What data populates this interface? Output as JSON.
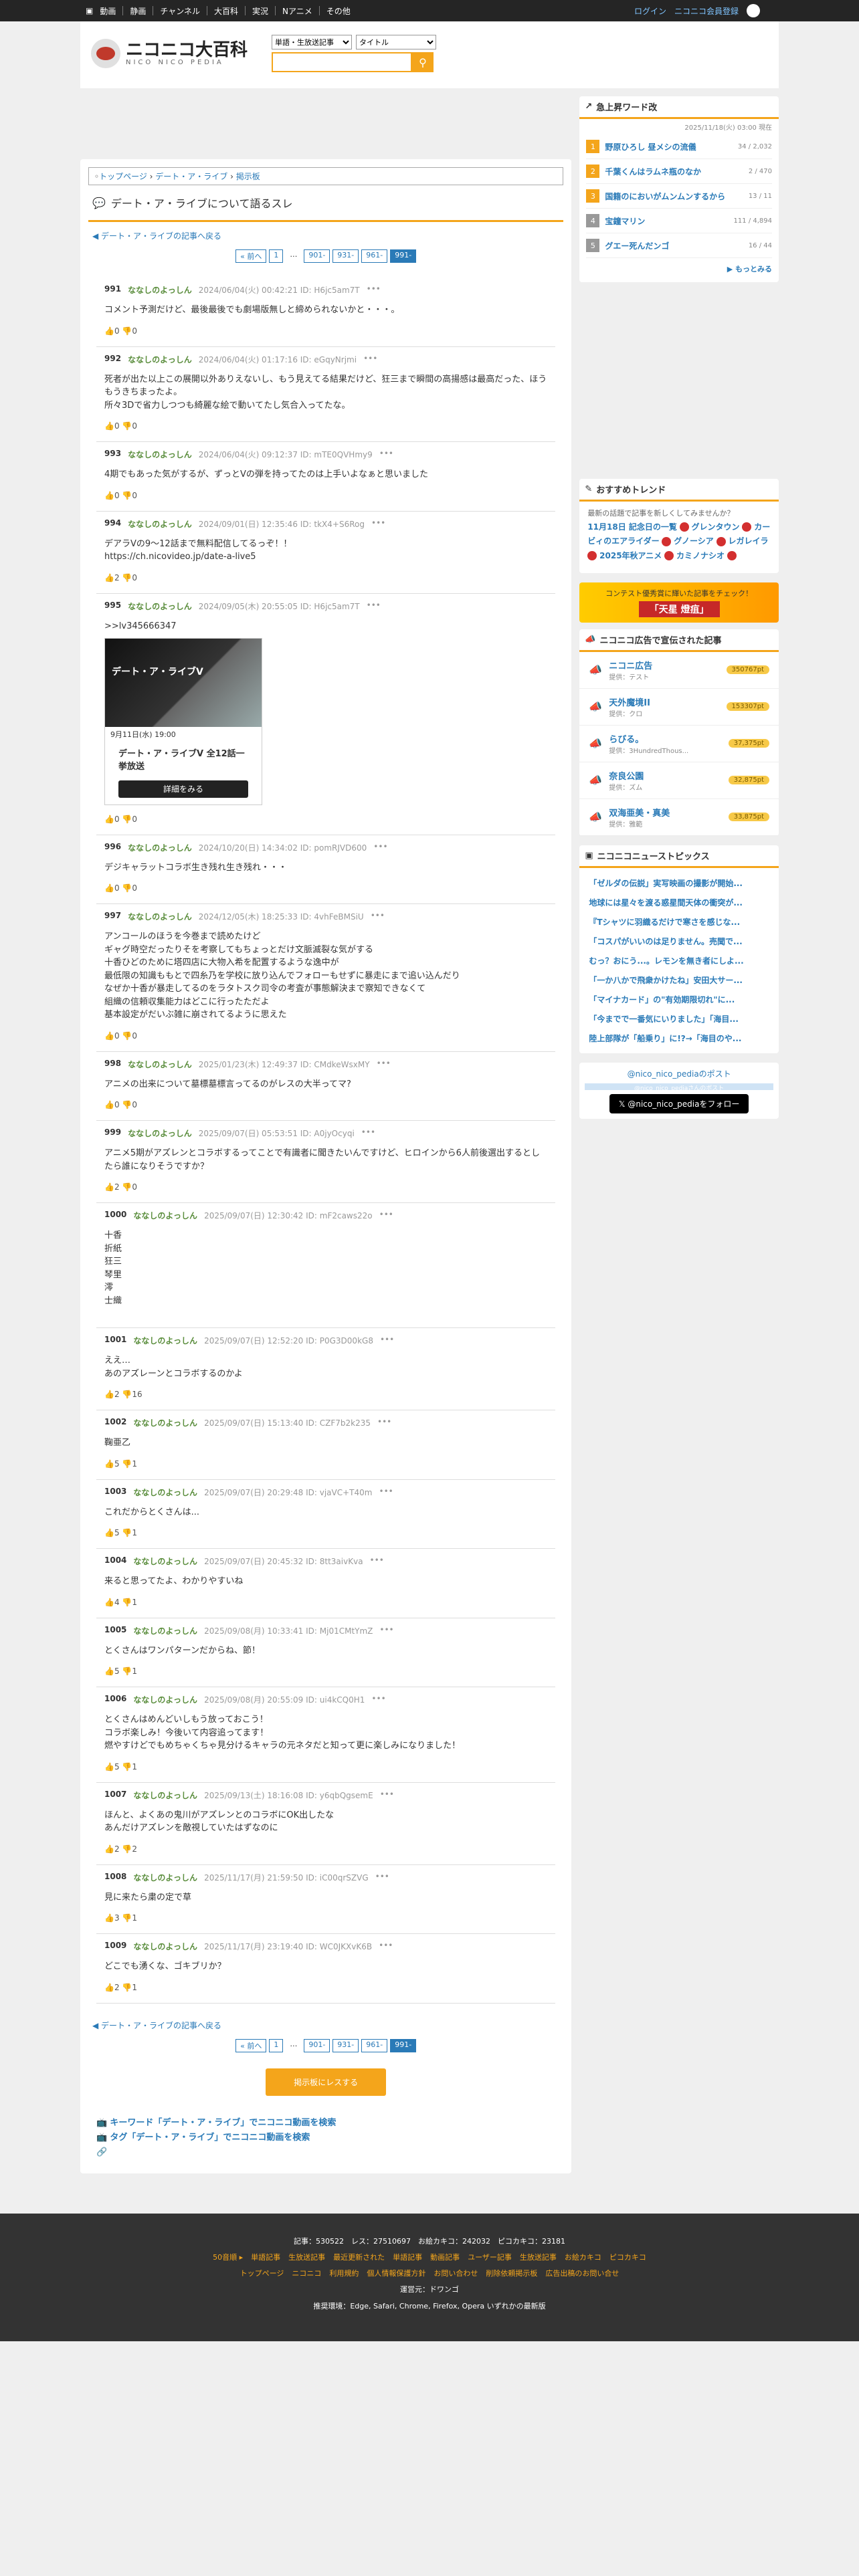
{
  "topbar": {
    "nav": [
      "動画",
      "静画",
      "チャンネル",
      "大百科",
      "実況",
      "Nアニメ",
      "その他"
    ],
    "login": "ログイン",
    "register": "ニコニコ会員登録"
  },
  "header": {
    "logo_title": "ニコニコ大百科",
    "logo_sub": "NICO NICO PEDIA",
    "select1": "単語・生放送記事",
    "select2": "タイトル"
  },
  "breadcrumb": [
    "トップページ",
    "デート・ア・ライブ",
    "掲示板"
  ],
  "page_title": "デート・ア・ライブについて語るスレ",
  "back_link": "デート・ア・ライブの記事へ戻る",
  "pager": [
    "« 前へ",
    "1",
    "…",
    "901-",
    "931-",
    "961-",
    "991-"
  ],
  "posts": [
    {
      "num": "991",
      "name": "ななしのよっしん",
      "meta": "2024/06/04(火) 00:42:21 ID: H6jc5am7T",
      "lines": [
        "コメント予測だけど、最後最後でも劇場版無しと締められないかと・・・。"
      ],
      "votes": "👍0 👎0"
    },
    {
      "num": "992",
      "name": "ななしのよっしん",
      "meta": "2024/06/04(火) 01:17:16 ID: eGqyNrjmi",
      "lines": [
        "死者が出た以上この展開以外ありえないし、もう見えてる結果だけど、狂三まで瞬間の高揚感は最高だった、ほうもうきちまったよ。",
        "所々3Dで省力しつつも綺麗な絵で動いてたし気合入ってたな。"
      ],
      "votes": "👍0 👎0"
    },
    {
      "num": "993",
      "name": "ななしのよっしん",
      "meta": "2024/06/04(火) 09:12:37 ID: mTE0QVHmy9",
      "lines": [
        "4期でもあった気がするが、ずっとVの弾を持ってたのは上手いよなぁと思いました"
      ],
      "votes": "👍0 👎0"
    },
    {
      "num": "994",
      "name": "ななしのよっしん",
      "meta": "2024/09/01(日) 12:35:46 ID: tkX4+S6Rog",
      "lines": [
        "デアラVの9〜12話まで無料配信してるっぞ！！",
        "https://ch.nicovideo.jp/date-a-live5"
      ],
      "votes": "👍2 👎0"
    },
    {
      "num": "995",
      "name": "ななしのよっしん",
      "meta": "2024/09/05(木) 20:55:05 ID: H6jc5am7T",
      "lines": [
        ">>lv345666347"
      ],
      "votes": "👍0 👎0",
      "embed": true
    },
    {
      "num": "996",
      "name": "ななしのよっしん",
      "meta": "2024/10/20(日) 14:34:02 ID: pomRJVD600",
      "lines": [
        "デジキャラットコラボ生き残れ生き残れ・・・"
      ],
      "votes": "👍0 👎0"
    },
    {
      "num": "997",
      "name": "ななしのよっしん",
      "meta": "2024/12/05(木) 18:25:33 ID: 4vhFeBMSiU",
      "lines": [
        "アンコールのほうを今巻まで読めたけど",
        "ギャグ時空だったりそを考察してもちょっとだけ文脈滅裂な気がする",
        "十香ひどのために塔四店に大物入希を配置するような逸中が",
        "最低限の知識ももとで四糸乃を学校に放り込んでフォローもせずに暴走にまで追い込んだり",
        "なぜか十香が暴走してるのをラタトスク司令の考査が事態解決まで察知できなくて",
        "組織の信頼収集能力はどこに行ったただよ",
        "基本設定がだいぶ雑に崩されてるように思えた"
      ],
      "votes": "👍0 👎0"
    },
    {
      "num": "998",
      "name": "ななしのよっしん",
      "meta": "2025/01/23(木) 12:49:37 ID: CMdkeWsxMY",
      "lines": [
        "アニメの出来について墓標墓標言ってるのがレスの大半ってマ?"
      ],
      "votes": "👍0 👎0"
    },
    {
      "num": "999",
      "name": "ななしのよっしん",
      "meta": "2025/09/07(日) 05:53:51 ID: A0jyOcyqi",
      "lines": [
        "アニメ5期がアズレンとコラボするってことで有識者に聞きたいんですけど、ヒロインから6人前後選出するとしたら誰になりそうですか？"
      ],
      "votes": "👍2 👎0"
    },
    {
      "num": "1000",
      "name": "ななしのよっしん",
      "meta": "2025/09/07(日) 12:30:42 ID: mF2caws22o",
      "lines": [
        "十香",
        "折紙",
        "狂三",
        "琴里",
        "澪",
        "士織"
      ],
      "votes": ""
    },
    {
      "num": "1001",
      "name": "ななしのよっしん",
      "meta": "2025/09/07(日) 12:52:20 ID: P0G3D00kG8",
      "lines": [
        "ええ…",
        "あのアズレーンとコラボするのかよ"
      ],
      "votes": "👍2 👎16"
    },
    {
      "num": "1002",
      "name": "ななしのよっしん",
      "meta": "2025/09/07(日) 15:13:40 ID: CZF7b2k235",
      "lines": [
        "鞠亜乙"
      ],
      "votes": "👍5 👎1"
    },
    {
      "num": "1003",
      "name": "ななしのよっしん",
      "meta": "2025/09/07(日) 20:29:48 ID: vjaVC+T40m",
      "lines": [
        "これだからとくさんは..."
      ],
      "votes": "👍5 👎1"
    },
    {
      "num": "1004",
      "name": "ななしのよっしん",
      "meta": "2025/09/07(日) 20:45:32 ID: 8tt3aivKva",
      "lines": [
        "来ると思ってたよ、わかりやすいね"
      ],
      "votes": "👍4 👎1"
    },
    {
      "num": "1005",
      "name": "ななしのよっしん",
      "meta": "2025/09/08(月) 10:33:41 ID: Mj01CMtYmZ",
      "lines": [
        "とくさんはワンパターンだからね、節！"
      ],
      "votes": "👍5 👎1"
    },
    {
      "num": "1006",
      "name": "ななしのよっしん",
      "meta": "2025/09/08(月) 20:55:09 ID: ui4kCQ0H1",
      "lines": [
        "とくさんはめんどいしもう放っておこう！",
        "コラボ楽しみ！今後いて内容追ってます！",
        "燃やすけどでもめちゃくちゃ見分けるキャラの元ネタだと知って更に楽しみになりました！"
      ],
      "votes": "👍5 👎1"
    },
    {
      "num": "1007",
      "name": "ななしのよっしん",
      "meta": "2025/09/13(土) 18:16:08 ID: y6qbQgsemE",
      "lines": [
        "ほんと、よくあの鬼川がアズレンとのコラボにOK出したな",
        "あんだけアズレンを敵視していたはずなのに"
      ],
      "votes": "👍2 👎2"
    },
    {
      "num": "1008",
      "name": "ななしのよっしん",
      "meta": "2025/11/17(月) 21:59:50 ID: iC00qrSZVG",
      "lines": [
        "見に来たら粛の定で草"
      ],
      "votes": "👍3 👎1"
    },
    {
      "num": "1009",
      "name": "ななしのよっしん",
      "meta": "2025/11/17(月) 23:19:40 ID: WC0JKXvK6B",
      "lines": [
        "どこでも湧くな、ゴキブリか？"
      ],
      "votes": "👍2 👎1"
    }
  ],
  "embed": {
    "title_img": "デート・ア・ライブV",
    "date": "9月11日(水) 19:00",
    "title": "デート・ア・ライブV 全12話一挙放送",
    "btn": "詳細をみる"
  },
  "show_all": "掲示板にレスする",
  "foot_links": [
    "キーワード「デート・ア・ライブ」でニコニコ動画を検索",
    "タグ「デート・ア・ライブ」でニコニコ動画を検索"
  ],
  "side": {
    "rank_title": "急上昇ワード改",
    "rank_date": "2025/11/18(火) 03:00 現在",
    "rank": [
      {
        "no": "1",
        "t": "野原ひろし 昼メシの流儀",
        "c": "34 / 2,032"
      },
      {
        "no": "2",
        "t": "千葉くんはラムネ瓶のなか",
        "c": "2 / 470"
      },
      {
        "no": "3",
        "t": "国籍のにおいがムンムンするから",
        "c": "13 / 11"
      },
      {
        "no": "4",
        "t": "宝鐘マリン",
        "c": "111 / 4,894"
      },
      {
        "no": "5",
        "t": "グエー死んだンゴ",
        "c": "16 / 44"
      }
    ],
    "rank_more": "もっとみる",
    "trend_title": "おすすめトレンド",
    "trend_q": "最新の話題で記事を新しくしてみませんか？",
    "trend_items": [
      "11月18日 記念日の一覧",
      "グレンタウン",
      "カービィのエアライダー",
      "グノーシア",
      "レガレイラ",
      "2025年秋アニメ",
      "カミノナシオ"
    ],
    "banner1": "コンテスト優秀賞に輝いた記事をチェック！",
    "banner2": "「天星 燈疽」",
    "ad_title": "ニコニコ広告で宣伝された記事",
    "ads": [
      {
        "nm": "ニコニ広告",
        "sub": "提供：テスト",
        "pt": "350767pt"
      },
      {
        "nm": "天外魔境II",
        "sub": "提供：クロ",
        "pt": "153307pt"
      },
      {
        "nm": "らびる。",
        "sub": "提供：3HundredThous...",
        "pt": "37,375pt"
      },
      {
        "nm": "奈良公園",
        "sub": "提供：ズム",
        "pt": "32,875pt"
      },
      {
        "nm": "双海亜美・真美",
        "sub": "提供：雅範",
        "pt": "33,875pt"
      }
    ],
    "news_title": "ニコニコニューストピックス",
    "news": [
      "「ゼルダの伝説」実写映画の撮影が開始...",
      "地球には星々を渡る惑星間天体の衝突が...",
      "『Tシャツに羽織るだけで寒さを感じな...",
      "「コスパがいいのは足りません。売聞で...",
      "むっ？おにう...。レモンを無き者にしよ...",
      "「一か八かで飛衆かけたね」安田大サー...",
      "「マイナカード」の\"有効期限切れ\"に...",
      "「今までで一番気にいりました」「海目...",
      "陸上部隊が「船乗り」に!?→「海目のや..."
    ],
    "x_title": "@nico_nico_pediaのポスト",
    "x_bar": "@nico_nico_pediaさんのポスト",
    "x_btn": "@nico_nico_pediaをフォロー"
  },
  "footer": {
    "stats": "記事：530522　レス：27510697　お絵カキコ：242032　ピコカキコ：23181",
    "row1": [
      "50音順 ▸",
      "単語記事",
      "生放送記事",
      "最近更新された",
      "単語記事",
      "動画記事",
      "ユーザー記事",
      "生放送記事",
      "お絵カキコ",
      "ピコカキコ"
    ],
    "row2": [
      "トップページ",
      "ニコニコ",
      "利用規約",
      "個人情報保護方針",
      "お問い合わせ",
      "削除依頼掲示板",
      "広告出稿のお問い合せ"
    ],
    "operator": "運営元：ドワンゴ",
    "browsers": "推奨環境：Edge, Safari, Chrome, Firefox, Opera いずれかの最新版"
  }
}
